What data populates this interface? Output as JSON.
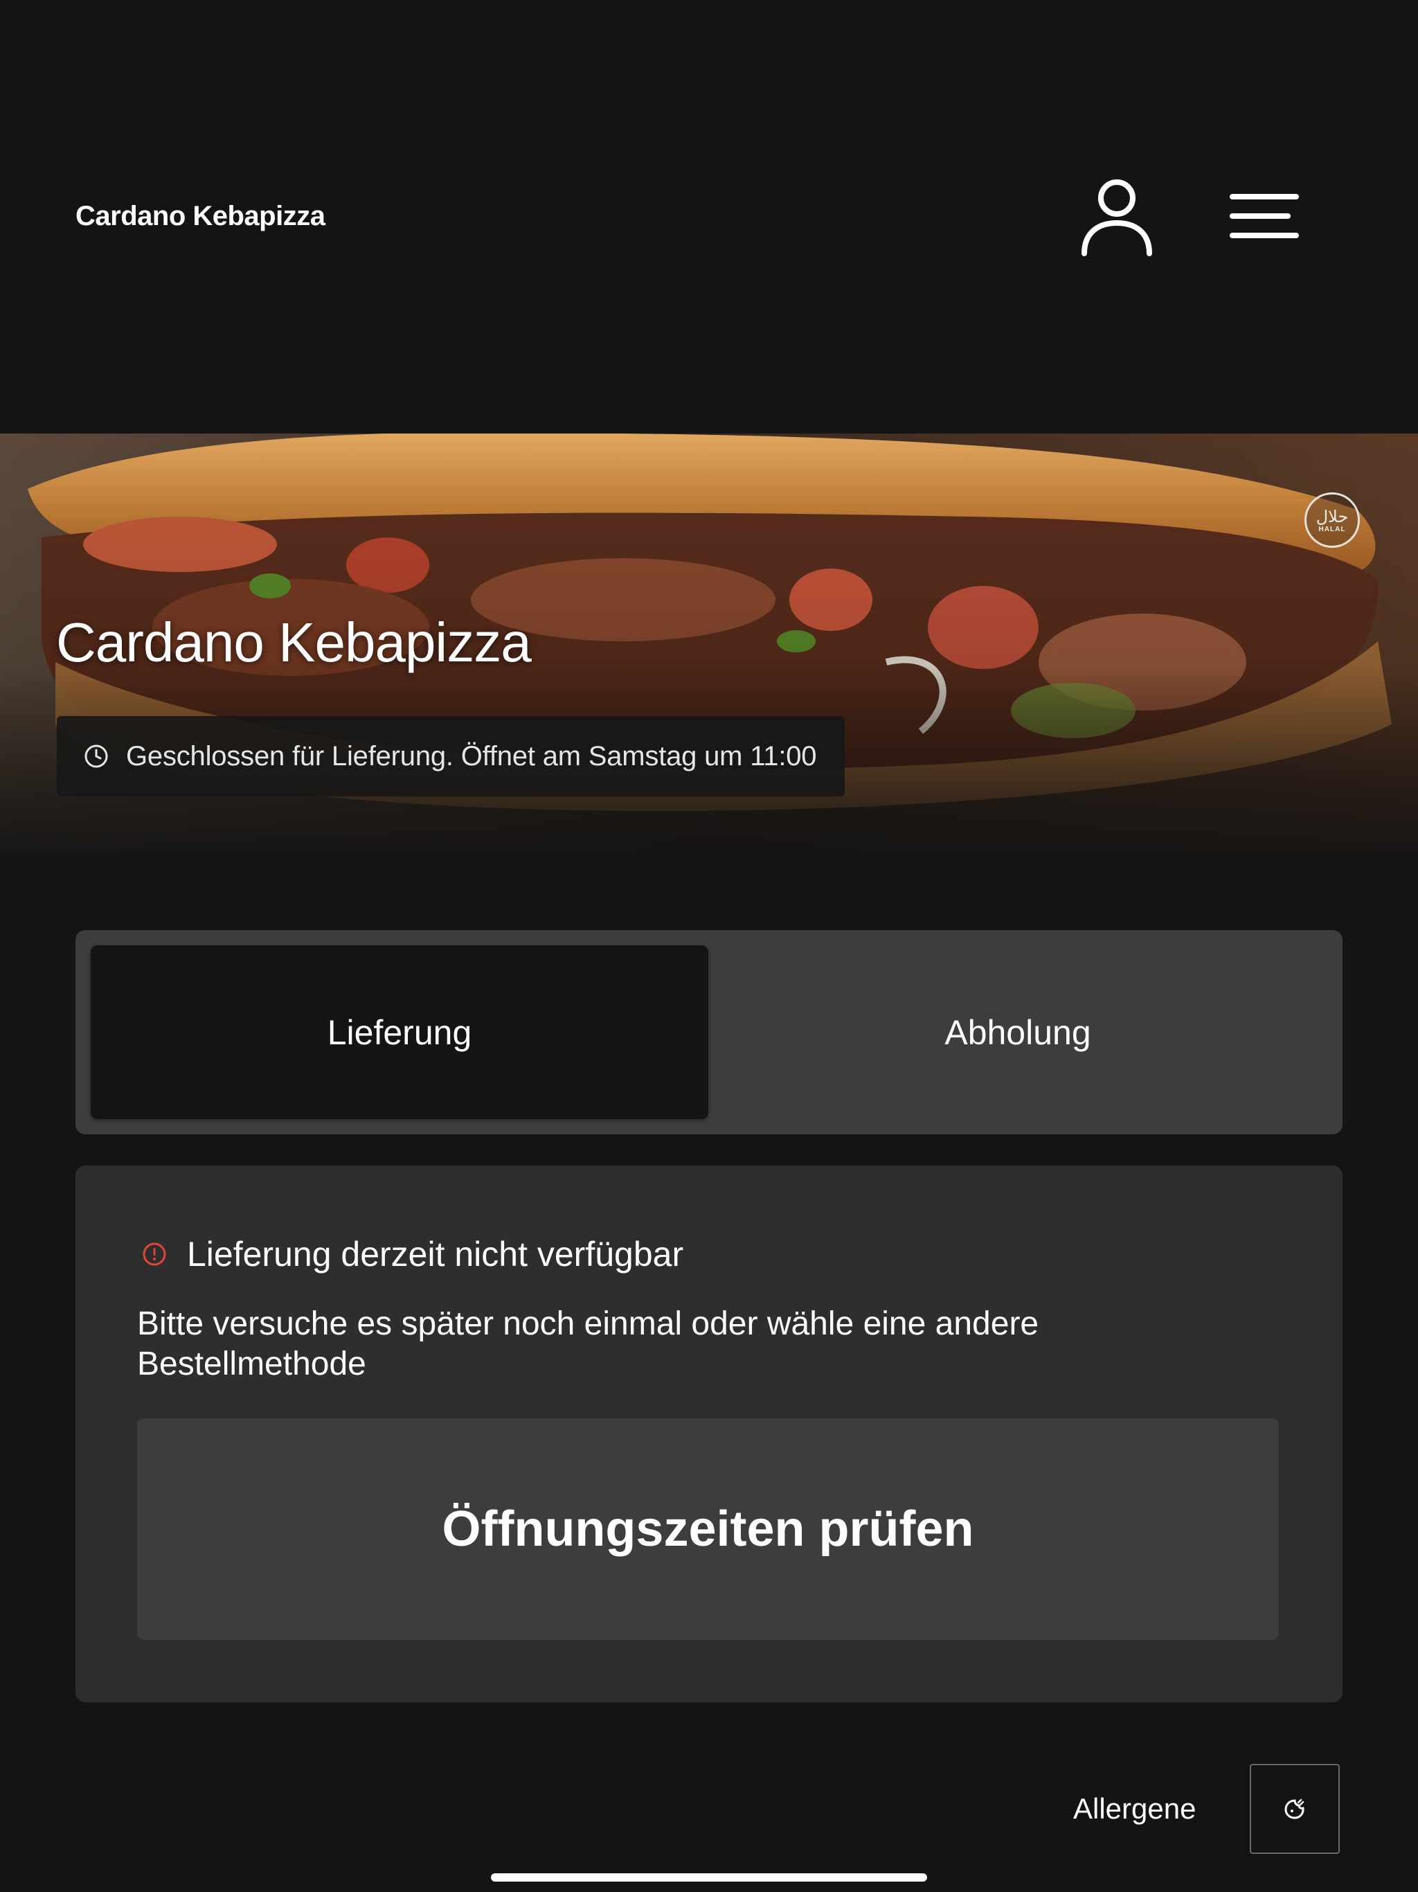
{
  "header": {
    "brand": "Cardano Kebapizza",
    "icons": [
      "user-icon",
      "hamburger-menu-icon"
    ]
  },
  "hero": {
    "title": "Cardano Kebapizza",
    "badge": {
      "arabic": "حلال",
      "latin": "HALAL"
    },
    "status": "Geschlossen für Lieferung. Öffnet am Samstag um 11:00",
    "status_icon": "clock-icon"
  },
  "tabs": {
    "items": [
      {
        "label": "Lieferung",
        "active": true
      },
      {
        "label": "Abholung",
        "active": false
      }
    ]
  },
  "notice": {
    "title": "Lieferung derzeit nicht verfügbar",
    "title_icon": "info-icon",
    "message": "Bitte versuche es später noch einmal oder wähle eine andere Bestellmethode",
    "button_label": "Öffnungszeiten prüfen"
  },
  "footer": {
    "allergens_label": "Allergene",
    "cookie_icon": "cookie-icon"
  },
  "colors": {
    "background": "#141414",
    "tab_bar": "#3d3d3d",
    "card": "#2e2e2e",
    "button": "#3d3d3d",
    "info_red": "#e0453a"
  }
}
